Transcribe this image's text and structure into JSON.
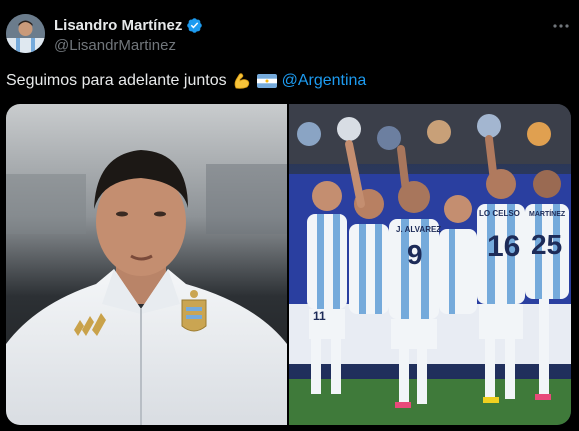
{
  "author": {
    "display_name": "Lisandro Martínez",
    "handle": "@LisandrMartinez",
    "verified": true,
    "avatar_icon": "player-avatar"
  },
  "tweet": {
    "text": "Seguimos para adelante juntos",
    "emojis": [
      "flexed-biceps-emoji",
      "argentina-flag-emoji"
    ],
    "mention": "@Argentina"
  },
  "media": {
    "photos": [
      {
        "subject": "player-portrait-photo"
      },
      {
        "subject": "team-celebration-photo"
      }
    ],
    "jersey_text": {
      "player_1": "LO CELSO",
      "player_2": "MARTÍNEZ",
      "player_3": "J. ALVAREZ",
      "number_1": "9",
      "number_2": "16",
      "number_3": "25",
      "number_4": "11"
    }
  },
  "colors": {
    "background": "#000000",
    "text_primary": "#e7e9ea",
    "text_secondary": "#71767b",
    "accent_blue": "#1d9bf0",
    "argentina_sky": "#75aadb"
  }
}
